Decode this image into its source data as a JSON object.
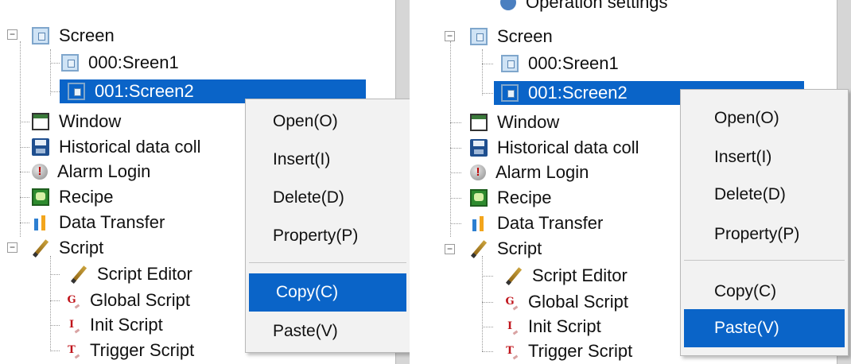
{
  "colors": {
    "selection": "#0a64c8",
    "menu_background": "#f2f2f2"
  },
  "left_panel": {
    "top_partial_label": "",
    "tree": [
      {
        "label": "Screen",
        "icon": "screen-icon",
        "expander": "−"
      },
      {
        "label": "000:Sreen1",
        "icon": "screen-icon"
      },
      {
        "label": "001:Screen2",
        "icon": "screen-icon",
        "selected": true
      },
      {
        "label": "Window",
        "icon": "window-icon"
      },
      {
        "label": "Historical data coll",
        "icon": "disk-icon"
      },
      {
        "label": "Alarm Login",
        "icon": "alarm-icon"
      },
      {
        "label": "Recipe",
        "icon": "recipe-icon"
      },
      {
        "label": "Data Transfer",
        "icon": "data-transfer-icon"
      },
      {
        "label": "Script",
        "icon": "pencil-icon",
        "expander": "−"
      },
      {
        "label": "Script Editor",
        "icon": "pencil-icon"
      },
      {
        "label": "Global Script",
        "icon": "global-script-icon",
        "letter": "G"
      },
      {
        "label": "Init Script",
        "icon": "init-script-icon",
        "letter": "I"
      },
      {
        "label": "Trigger Script",
        "icon": "trigger-script-icon",
        "letter": "T"
      }
    ],
    "context_menu": {
      "items": [
        "Open(O)",
        "Insert(I)",
        "Delete(D)",
        "Property(P)",
        "Copy(C)",
        "Paste(V)"
      ],
      "highlighted": "Copy(C)"
    }
  },
  "right_panel": {
    "top_partial_label": "Operation settings",
    "tree": [
      {
        "label": "Screen",
        "icon": "screen-icon",
        "expander": "−"
      },
      {
        "label": "000:Sreen1",
        "icon": "screen-icon"
      },
      {
        "label": "001:Screen2",
        "icon": "screen-icon",
        "selected": true
      },
      {
        "label": "Window",
        "icon": "window-icon"
      },
      {
        "label": "Historical data coll",
        "icon": "disk-icon"
      },
      {
        "label": "Alarm Login",
        "icon": "alarm-icon"
      },
      {
        "label": "Recipe",
        "icon": "recipe-icon"
      },
      {
        "label": "Data Transfer",
        "icon": "data-transfer-icon"
      },
      {
        "label": "Script",
        "icon": "pencil-icon",
        "expander": "−"
      },
      {
        "label": "Script Editor",
        "icon": "pencil-icon"
      },
      {
        "label": "Global Script",
        "icon": "global-script-icon",
        "letter": "G"
      },
      {
        "label": "Init Script",
        "icon": "init-script-icon",
        "letter": "I"
      },
      {
        "label": "Trigger Script",
        "icon": "trigger-script-icon",
        "letter": "T"
      }
    ],
    "context_menu": {
      "items": [
        "Open(O)",
        "Insert(I)",
        "Delete(D)",
        "Property(P)",
        "Copy(C)",
        "Paste(V)"
      ],
      "highlighted": "Paste(V)"
    }
  }
}
